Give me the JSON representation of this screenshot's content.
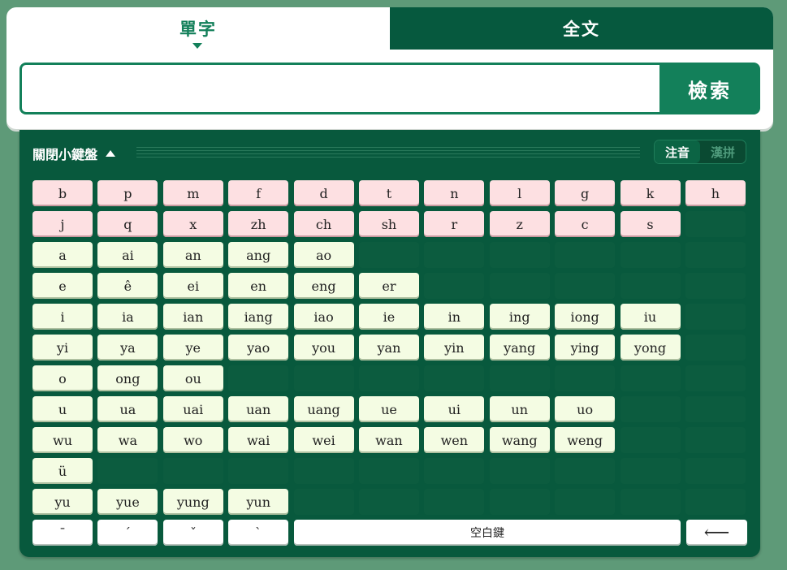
{
  "tabs": [
    {
      "label": "單字",
      "active": true
    },
    {
      "label": "全文",
      "active": false
    }
  ],
  "search": {
    "value": "",
    "button_label": "檢索"
  },
  "keyboard": {
    "toggle_label": "關閉小鍵盤",
    "modes": [
      "注音",
      "漢拼"
    ],
    "active_mode": "注音",
    "rows": [
      {
        "type": "init",
        "keys": [
          "b",
          "p",
          "m",
          "f",
          "d",
          "t",
          "n",
          "l",
          "g",
          "k",
          "h"
        ]
      },
      {
        "type": "init",
        "keys": [
          "j",
          "q",
          "x",
          "zh",
          "ch",
          "sh",
          "r",
          "z",
          "c",
          "s"
        ]
      },
      {
        "type": "final",
        "keys": [
          "a",
          "ai",
          "an",
          "ang",
          "ao"
        ]
      },
      {
        "type": "final",
        "keys": [
          "e",
          "ê",
          "ei",
          "en",
          "eng",
          "er"
        ]
      },
      {
        "type": "final",
        "keys": [
          "i",
          "ia",
          "ian",
          "iang",
          "iao",
          "ie",
          "in",
          "ing",
          "iong",
          "iu"
        ]
      },
      {
        "type": "final",
        "keys": [
          "yi",
          "ya",
          "ye",
          "yao",
          "you",
          "yan",
          "yin",
          "yang",
          "ying",
          "yong"
        ]
      },
      {
        "type": "final",
        "keys": [
          "o",
          "ong",
          "ou"
        ]
      },
      {
        "type": "final",
        "keys": [
          "u",
          "ua",
          "uai",
          "uan",
          "uang",
          "ue",
          "ui",
          "un",
          "uo"
        ]
      },
      {
        "type": "final",
        "keys": [
          "wu",
          "wa",
          "wo",
          "wai",
          "wei",
          "wan",
          "wen",
          "wang",
          "weng"
        ]
      },
      {
        "type": "final",
        "keys": [
          "ü"
        ]
      },
      {
        "type": "final",
        "keys": [
          "yu",
          "yue",
          "yung",
          "yun"
        ]
      }
    ],
    "tones": [
      "ˉ",
      "ˊ",
      "ˇ",
      "ˋ"
    ],
    "space_label": "空白鍵",
    "backspace_label": "⟵",
    "colors": {
      "initial_key": "#fde0e2",
      "final_key": "#f4fce3",
      "panel": "#08593d",
      "accent": "#13805a"
    }
  }
}
